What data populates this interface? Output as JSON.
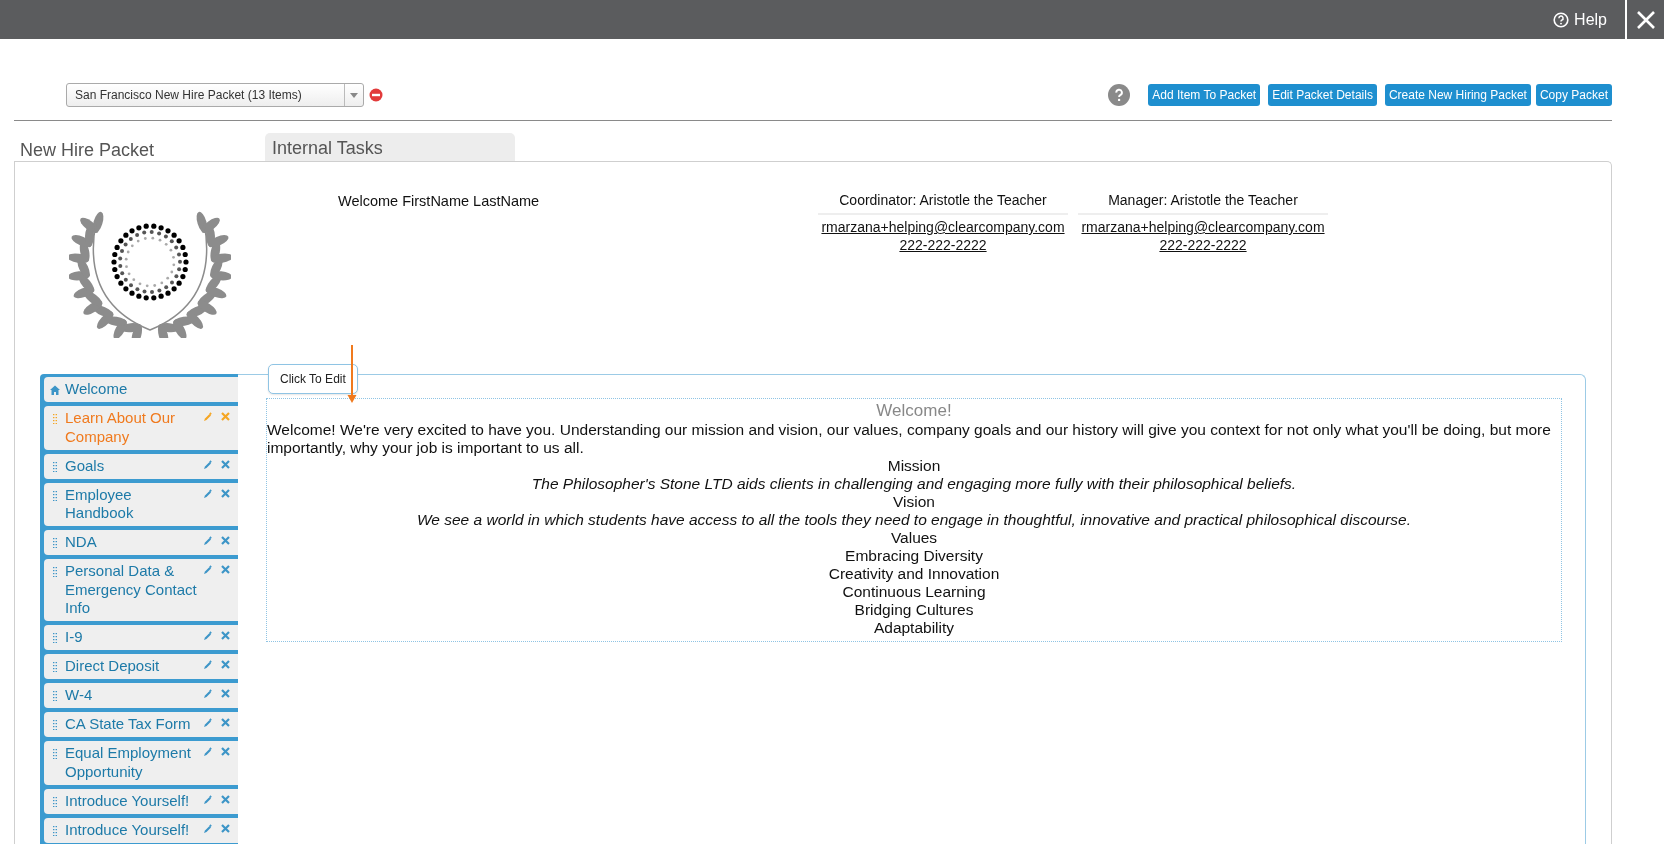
{
  "header": {
    "help": "Help"
  },
  "packet_select": {
    "value": "San Francisco New Hire Packet (13 Items)"
  },
  "toolbar_buttons": [
    "Add Item To Packet",
    "Edit Packet Details",
    "Create New Hiring Packet",
    "Copy Packet"
  ],
  "section_title": "New Hire Packet",
  "tab": "Internal Tasks",
  "greeting": "Welcome FirstName LastName",
  "contacts": [
    {
      "role": "Coordinator: Aristotle the Teacher",
      "email": "rmarzana+helping@clearcompany.com",
      "phone": "222-222-2222"
    },
    {
      "role": "Manager: Aristotle the Teacher",
      "email": "rmarzana+helping@clearcompany.com",
      "phone": "222-222-2222"
    }
  ],
  "sidebar": {
    "items": [
      {
        "label": "Welcome",
        "kind": "home",
        "selected": false
      },
      {
        "label": "Learn About Our Company",
        "kind": "item",
        "selected": true
      },
      {
        "label": "Goals",
        "kind": "item",
        "selected": false
      },
      {
        "label": "Employee Handbook",
        "kind": "item",
        "selected": false
      },
      {
        "label": "NDA",
        "kind": "item",
        "selected": false
      },
      {
        "label": "Personal Data & Emergency Contact Info",
        "kind": "item",
        "selected": false
      },
      {
        "label": "I-9",
        "kind": "item",
        "selected": false
      },
      {
        "label": "Direct Deposit",
        "kind": "item",
        "selected": false
      },
      {
        "label": "W-4",
        "kind": "item",
        "selected": false
      },
      {
        "label": "CA State Tax Form",
        "kind": "item",
        "selected": false
      },
      {
        "label": "Equal Employment Opportunity",
        "kind": "item",
        "selected": false
      },
      {
        "label": "Introduce Yourself!",
        "kind": "item",
        "selected": false
      },
      {
        "label": "Introduce Yourself!",
        "kind": "item",
        "selected": false
      }
    ]
  },
  "tooltip": "Click To Edit",
  "content": {
    "title": "Welcome!",
    "intro": "Welcome! We're very excited to have you. Understanding our mission and vision, our values, company goals and our history will give you context for not only what you'll be doing, but more importantly, why your job is important to us all.",
    "lines": [
      {
        "text": "Mission",
        "kind": "heading"
      },
      {
        "text": "The Philosopher's Stone LTD aids clients in challenging and engaging more fully with their philosophical beliefs.",
        "kind": "statement"
      },
      {
        "text": "Vision",
        "kind": "heading"
      },
      {
        "text": "We see a world in which students have access to all the tools they need to engage in thoughtful, innovative and practical philosophical discourse.",
        "kind": "statement"
      },
      {
        "text": "Values",
        "kind": "heading"
      },
      {
        "text": "Embracing Diversity",
        "kind": "heading"
      },
      {
        "text": "Creativity and Innovation",
        "kind": "heading"
      },
      {
        "text": "Continuous Learning",
        "kind": "heading"
      },
      {
        "text": "Bridging Cultures",
        "kind": "heading"
      },
      {
        "text": "Adaptability",
        "kind": "heading"
      }
    ]
  }
}
